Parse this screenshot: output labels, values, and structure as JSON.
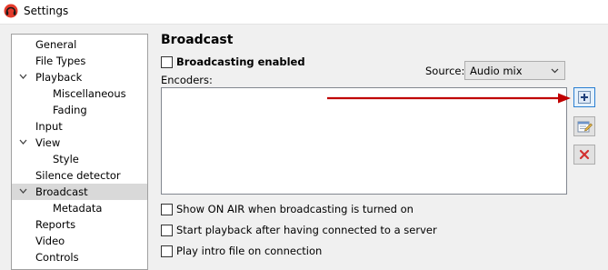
{
  "window": {
    "title": "Settings"
  },
  "tree": {
    "items": [
      {
        "label": "General"
      },
      {
        "label": "File Types"
      },
      {
        "label": "Playback"
      },
      {
        "label": "Miscellaneous"
      },
      {
        "label": "Fading"
      },
      {
        "label": "Input"
      },
      {
        "label": "View"
      },
      {
        "label": "Style"
      },
      {
        "label": "Silence detector"
      },
      {
        "label": "Broadcast"
      },
      {
        "label": "Metadata"
      },
      {
        "label": "Reports"
      },
      {
        "label": "Video"
      },
      {
        "label": "Controls"
      }
    ],
    "selected": "Broadcast"
  },
  "broadcast": {
    "title": "Broadcast",
    "enabled_label": "Broadcasting enabled",
    "source_label": "Source:",
    "source_value": "Audio mix",
    "encoders_label": "Encoders:",
    "options": [
      {
        "label": "Show ON AIR when broadcasting is turned on",
        "checked": false
      },
      {
        "label": "Start playback after having connected to a server",
        "checked": false
      },
      {
        "label": "Play intro file on connection",
        "checked": false
      }
    ]
  },
  "toolbar": {
    "buttons": [
      {
        "icon": "add-icon"
      },
      {
        "icon": "edit-icon"
      },
      {
        "icon": "delete-icon"
      }
    ]
  },
  "colors": {
    "annotation_arrow": "#c00000",
    "selection": "#d9d9d9",
    "active_button_border": "#2a7fd2",
    "delete_icon": "#d23030"
  }
}
